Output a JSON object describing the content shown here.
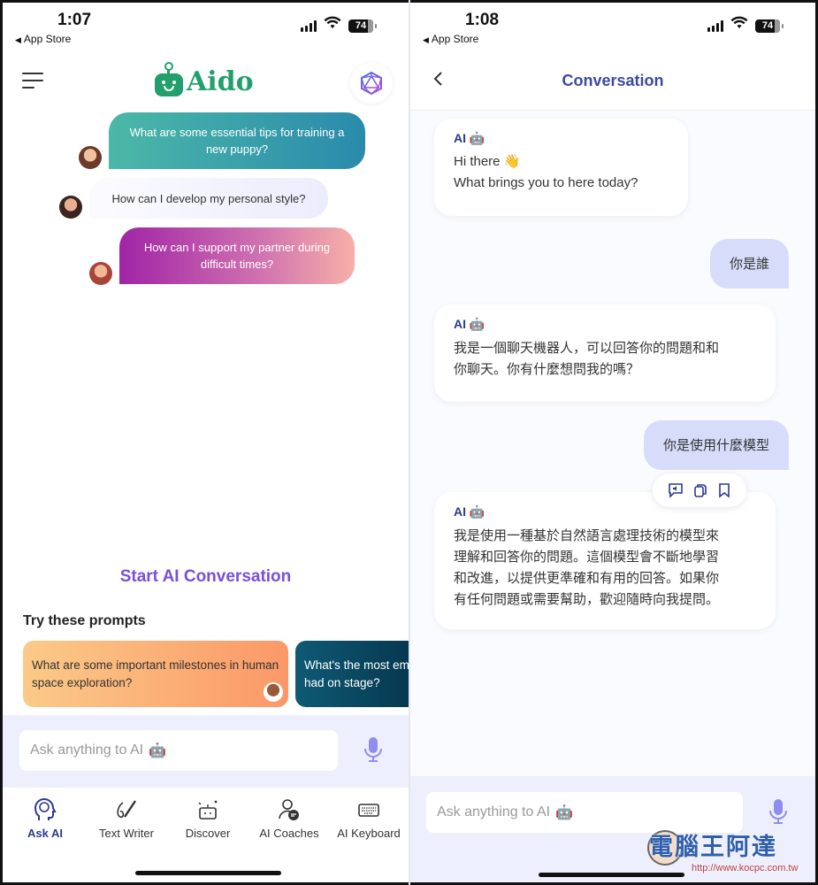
{
  "left": {
    "status": {
      "time": "1:07",
      "back_app": "App Store",
      "battery": "74"
    },
    "header": {
      "logo_text": "Aido"
    },
    "sample_prompts": [
      "What are some essential tips for training a new puppy?",
      "How can I develop my personal style?",
      "How can I support my partner during difficult times?"
    ],
    "start_label": "Start AI Conversation",
    "try_title": "Try these prompts",
    "prompt_cards": [
      "What are some important milestones in human space exploration?",
      "What's the most embarrassing moment you've had on stage?"
    ],
    "input": {
      "placeholder": "Ask anything to AI",
      "emoji": "🤖"
    },
    "nav": [
      {
        "label": "Ask AI",
        "icon": "brain-head-icon",
        "active": true
      },
      {
        "label": "Text Writer",
        "icon": "pen-icon",
        "active": false
      },
      {
        "label": "Discover",
        "icon": "robot-sparkle-icon",
        "active": false
      },
      {
        "label": "AI Coaches",
        "icon": "coach-icon",
        "active": false
      },
      {
        "label": "AI Keyboard",
        "icon": "keyboard-icon",
        "active": false
      }
    ]
  },
  "right": {
    "status": {
      "time": "1:08",
      "back_app": "App Store",
      "battery": "74"
    },
    "header": {
      "title": "Conversation"
    },
    "messages": [
      {
        "role": "ai",
        "tag": "AI",
        "lines": [
          "Hi there 👋",
          "What brings you to here today?"
        ]
      },
      {
        "role": "user",
        "text": "你是誰"
      },
      {
        "role": "ai",
        "tag": "AI",
        "lines": [
          "我是一個聊天機器人，可以回答你的問題和和",
          "你聊天。你有什麼想問我的嗎？"
        ]
      },
      {
        "role": "user",
        "text": "你是使用什麼模型"
      },
      {
        "role": "ai",
        "tag": "AI",
        "lines": [
          "我是使用一種基於自然語言處理技術的模型來",
          "理解和回答你的問題。這個模型會不斷地學習",
          "和改進，以提供更準確和有用的回答。如果你",
          "有任何問題或需要幫助，歡迎隨時向我提問。"
        ]
      }
    ],
    "input": {
      "placeholder": "Ask anything to AI",
      "emoji": "🤖"
    },
    "watermark": {
      "text": "電腦王阿達",
      "url": "http://www.kocpc.com.tw"
    }
  },
  "colors": {
    "brand_green": "#22a06b",
    "accent_purple": "#7a4fd8",
    "nav_active": "#2b3a8f",
    "user_bubble": "#d7dcfb"
  }
}
